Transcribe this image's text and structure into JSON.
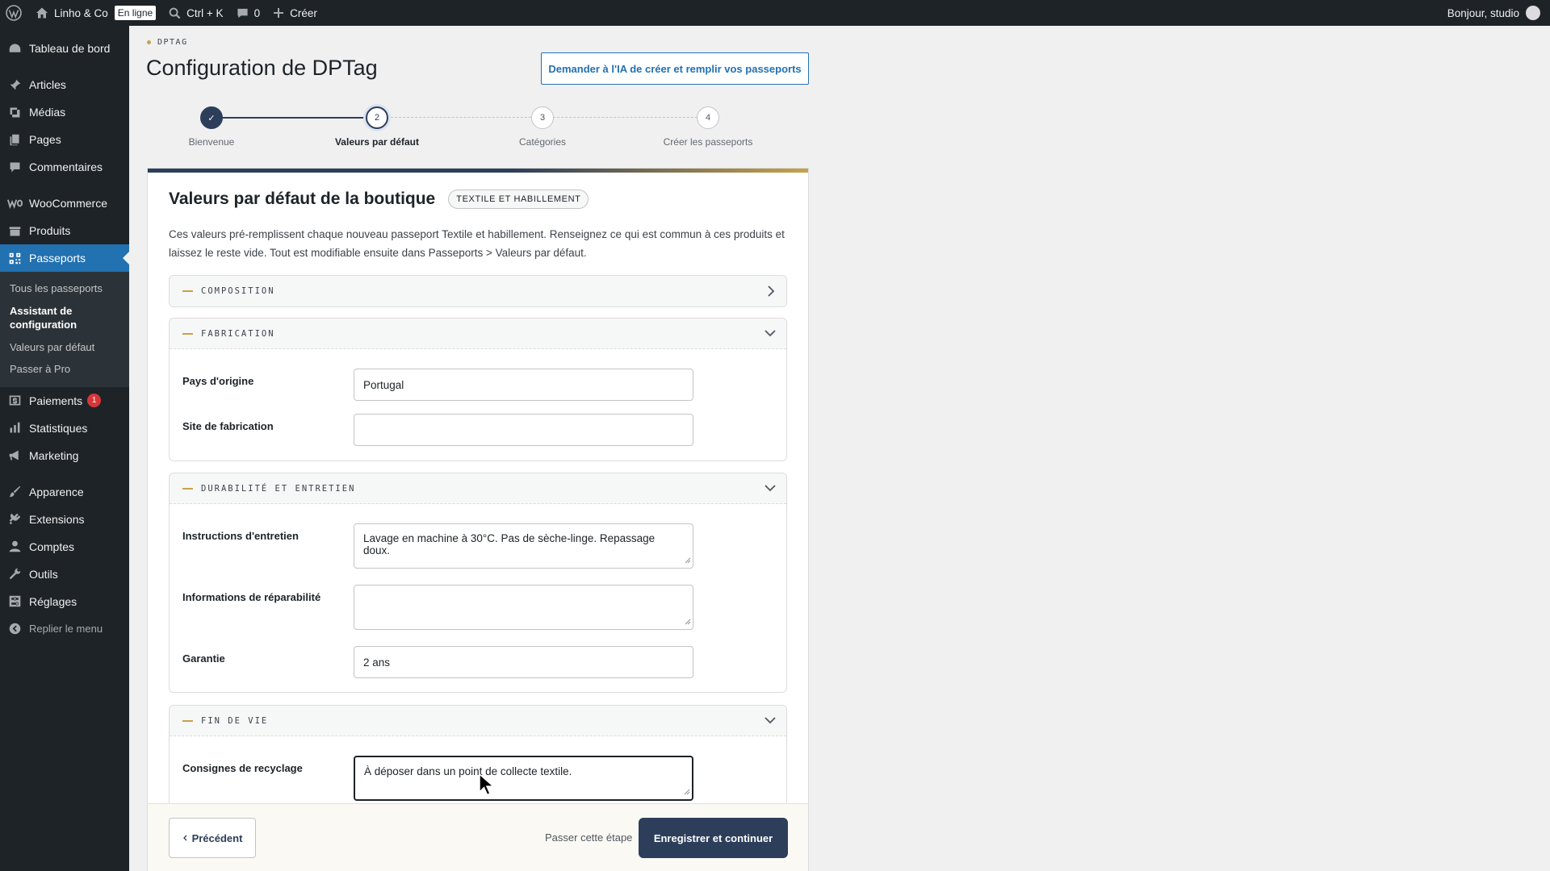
{
  "adminbar": {
    "site_name": "Linho & Co",
    "status_badge": "En ligne",
    "search_shortcut": "Ctrl + K",
    "comments_count": "0",
    "new_label": "Créer",
    "greeting": "Bonjour, studio"
  },
  "sidebar": {
    "dashboard": "Tableau de bord",
    "posts": "Articles",
    "media": "Médias",
    "pages": "Pages",
    "comments": "Commentaires",
    "woocommerce": "WooCommerce",
    "products": "Produits",
    "passports": "Passeports",
    "submenu": [
      "Tous les passeports",
      "Assistant de configuration",
      "Valeurs par défaut",
      "Passer à Pro"
    ],
    "payments": "Paiements",
    "payments_count": "1",
    "stats": "Statistiques",
    "marketing": "Marketing",
    "appearance": "Apparence",
    "plugins": "Extensions",
    "users": "Comptes",
    "tools": "Outils",
    "settings": "Réglages",
    "collapse": "Replier le menu"
  },
  "header": {
    "eyebrow": "DPTAG",
    "title": "Configuration de DPTag",
    "ai_button": "Demander à l'IA de créer et remplir vos passeports"
  },
  "stepper": {
    "steps": [
      {
        "number": "✓",
        "label": "Bienvenue"
      },
      {
        "number": "2",
        "label": "Valeurs par défaut"
      },
      {
        "number": "3",
        "label": "Catégories"
      },
      {
        "number": "4",
        "label": "Créer les passeports"
      }
    ]
  },
  "card": {
    "title": "Valeurs par défaut de la boutique",
    "category_chip": "TEXTILE ET HABILLEMENT",
    "description": "Ces valeurs pré-remplissent chaque nouveau passeport Textile et habillement. Renseignez ce qui est commun à ces produits et laissez le reste vide. Tout est modifiable ensuite dans Passeports > Valeurs par défaut."
  },
  "sections": {
    "composition": {
      "title": "COMPOSITION"
    },
    "fabrication": {
      "title": "FABRICATION",
      "country_label": "Pays d'origine",
      "country_value": "Portugal",
      "site_label": "Site de fabrication",
      "site_value": ""
    },
    "durability": {
      "title": "DURABILITÉ ET ENTRETIEN",
      "care_label": "Instructions d'entretien",
      "care_value": "Lavage en machine à 30°C. Pas de sèche-linge. Repassage doux.",
      "repair_label": "Informations de réparabilité",
      "repair_value": "",
      "warranty_label": "Garantie",
      "warranty_value": "2 ans"
    },
    "end_of_life": {
      "title": "FIN DE VIE",
      "recycling_label": "Consignes de recyclage",
      "recycling_value": "À déposer dans un point de collecte textile."
    }
  },
  "footer": {
    "prev_label": "Précédent",
    "skip_label": "Passer cette étape",
    "save_label": "Enregistrer et continuer"
  }
}
